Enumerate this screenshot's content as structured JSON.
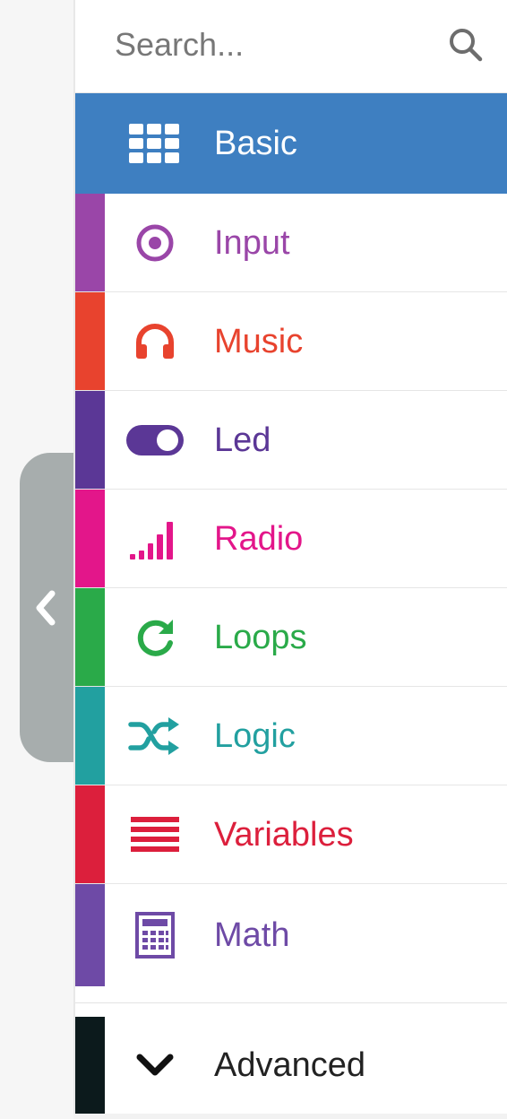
{
  "search": {
    "placeholder": "Search..."
  },
  "categories": [
    {
      "label": "Basic",
      "icon": "grid-icon",
      "color": "#3e7fc1",
      "selected": true
    },
    {
      "label": "Input",
      "icon": "target-icon",
      "color": "#9a46a8"
    },
    {
      "label": "Music",
      "icon": "headphones-icon",
      "color": "#e8432e"
    },
    {
      "label": "Led",
      "icon": "toggle-icon",
      "color": "#5b3796"
    },
    {
      "label": "Radio",
      "icon": "signal-bars-icon",
      "color": "#e3168a"
    },
    {
      "label": "Loops",
      "icon": "refresh-icon",
      "color": "#2aaa49"
    },
    {
      "label": "Logic",
      "icon": "shuffle-icon",
      "color": "#22a0a0"
    },
    {
      "label": "Variables",
      "icon": "list-lines-icon",
      "color": "#dc1f3c"
    },
    {
      "label": "Math",
      "icon": "calculator-icon",
      "color": "#6e4aa6"
    }
  ],
  "advanced": {
    "label": "Advanced",
    "icon": "chevron-down-icon",
    "color": "#0c1a1c"
  },
  "collapse": {
    "icon": "chevron-left-icon"
  }
}
